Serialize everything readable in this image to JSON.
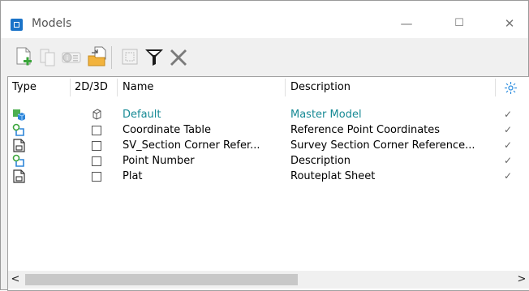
{
  "window": {
    "title": "Models",
    "buttons": {
      "minimize": "—",
      "maximize": "☐",
      "close": "✕"
    }
  },
  "toolbar": {
    "tools": [
      "new-model",
      "copy-model",
      "model-properties",
      "import-model",
      "select-all",
      "filter",
      "delete-model"
    ]
  },
  "columns": {
    "type": "Type",
    "dim": "2D/3D",
    "name": "Name",
    "description": "Description",
    "display_icon": "sun-icon"
  },
  "rows": [
    {
      "type_icon": "design-model-3d-icon",
      "dim": "3D",
      "name": "Default",
      "description": "Master Model",
      "active": true,
      "display": "✓"
    },
    {
      "type_icon": "point-table-icon",
      "dim": "2D",
      "name": "Coordinate Table",
      "description": "Reference Point Coordinates",
      "active": false,
      "display": "✓"
    },
    {
      "type_icon": "sheet-model-icon",
      "dim": "2D",
      "name": "SV_Section Corner Refer...",
      "description": "Survey Section Corner Reference...",
      "active": false,
      "display": "✓"
    },
    {
      "type_icon": "point-table-icon",
      "dim": "2D",
      "name": "Point Number",
      "description": "Description",
      "active": false,
      "display": "✓"
    },
    {
      "type_icon": "sheet-model-icon",
      "dim": "2D",
      "name": "Plat",
      "description": "Routeplat Sheet",
      "active": false,
      "display": "✓"
    }
  ],
  "scrollbar": {
    "left_arrow": "<",
    "right_arrow": ">"
  },
  "colors": {
    "active_text": "#178a95",
    "accent": "#1a73c8",
    "green": "#3aa53a"
  }
}
